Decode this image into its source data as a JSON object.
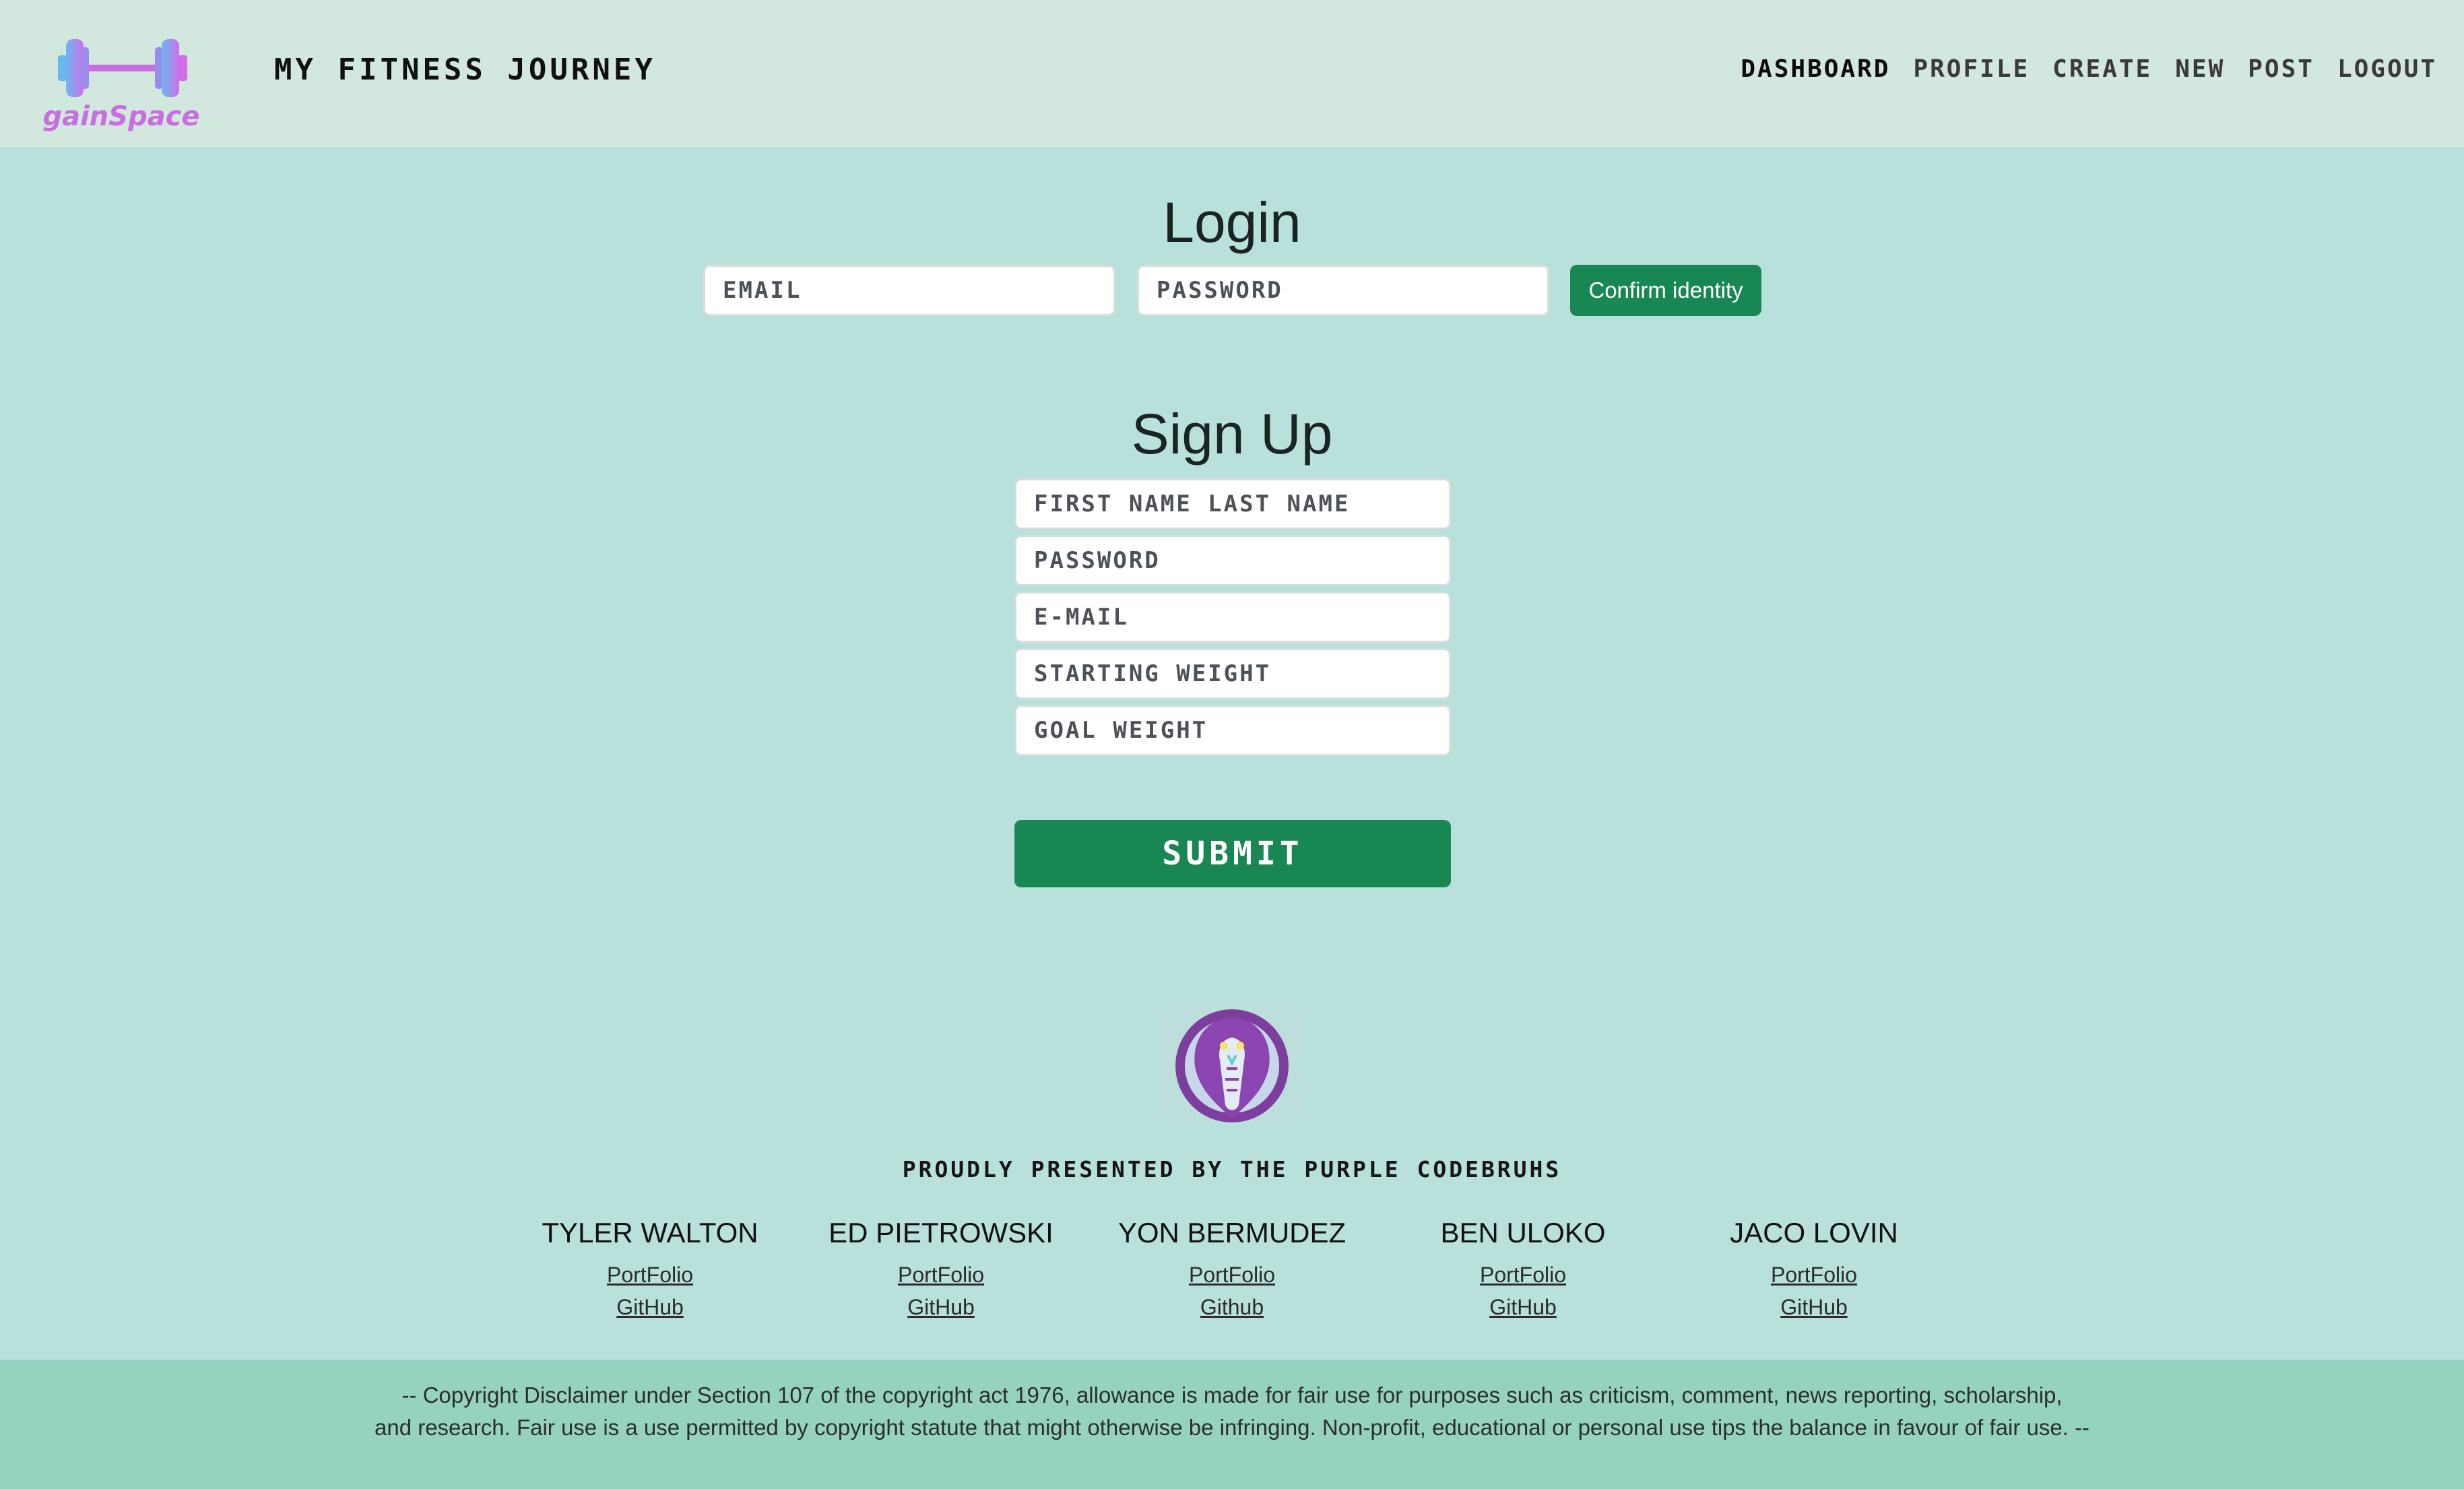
{
  "header": {
    "logo_text": "gainSpace",
    "title": "MY FITNESS JOURNEY",
    "nav": [
      "DASHBOARD",
      "PROFILE",
      "CREATE",
      "NEW",
      "POST",
      "LOGOUT"
    ]
  },
  "login": {
    "heading": "Login",
    "email_placeholder": "EMAIL",
    "password_placeholder": "PASSWORD",
    "confirm_label": "Confirm identity"
  },
  "signup": {
    "heading": "Sign Up",
    "fields": [
      "FIRST NAME LAST NAME",
      "PASSWORD",
      "E-MAIL",
      "STARTING WEIGHT",
      "GOAL WEIGHT"
    ],
    "submit_label": "SUBMIT"
  },
  "team": {
    "presented": "PROUDLY PRESENTED BY THE PURPLE CODEBRUHS",
    "members": [
      {
        "name": "TYLER WALTON",
        "link1": "PortFolio",
        "link2": "GitHub"
      },
      {
        "name": "ED PIETROWSKI",
        "link1": "PortFolio",
        "link2": "GitHub"
      },
      {
        "name": "YON BERMUDEZ",
        "link1": "PortFolio",
        "link2": "Github"
      },
      {
        "name": "BEN ULOKO",
        "link1": "PortFolio",
        "link2": "GitHub"
      },
      {
        "name": "JACO LOVIN",
        "link1": "PortFolio",
        "link2": "GitHub"
      }
    ]
  },
  "footer": {
    "line1": "-- Copyright Disclaimer under Section 107 of the copyright act 1976, allowance is made for fair use for purposes such as criticism, comment, news reporting, scholarship,",
    "line2": "and research. Fair use is a use permitted by copyright statute that might otherwise be infringing. Non-profit, educational or personal use tips the balance in favour of fair use. --"
  },
  "colors": {
    "header_bg": "#d2e7dd",
    "page_bg": "#b8e1dc",
    "footer_bg": "#95d2bf",
    "button_green": "#198754",
    "logo_purple": "#c86ee0",
    "logo_blue": "#6ab8ef"
  }
}
